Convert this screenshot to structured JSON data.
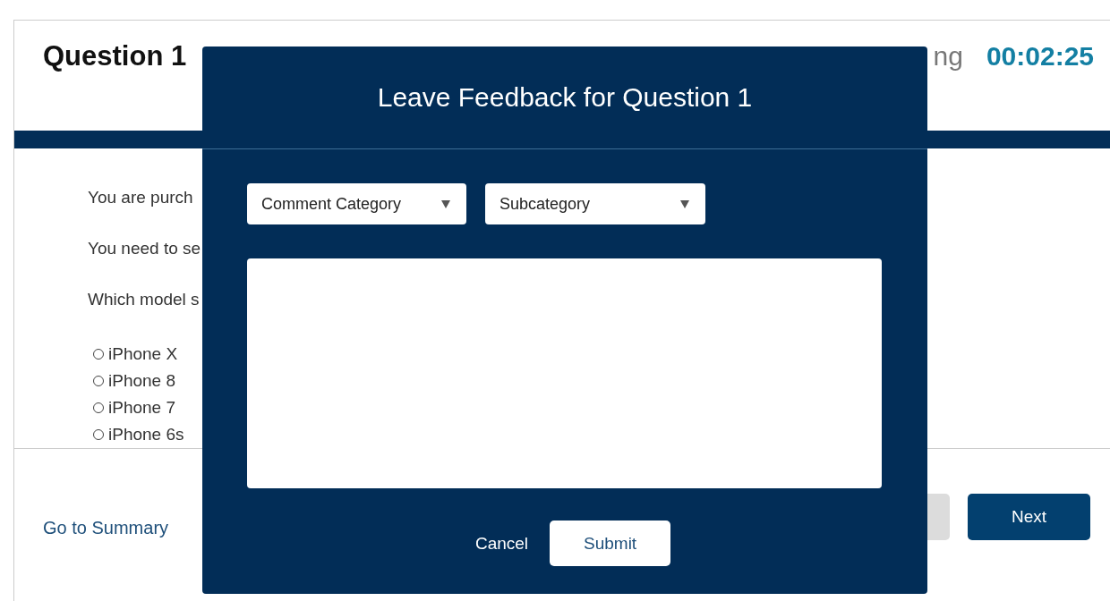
{
  "header": {
    "title": "Question 1",
    "timer_label": "ng",
    "timer": "00:02:25"
  },
  "question": {
    "lines": [
      "You are purch",
      "You need to se",
      "Which model s"
    ],
    "options": [
      {
        "label": "iPhone X",
        "selected": false
      },
      {
        "label": "iPhone 8",
        "selected": false
      },
      {
        "label": "iPhone 7",
        "selected": false
      },
      {
        "label": "iPhone 6s",
        "selected": false
      }
    ]
  },
  "footer": {
    "summary_link": "Go to Summary",
    "next_button": "Next"
  },
  "dialog": {
    "title": "Leave Feedback for Question 1",
    "category": "Comment Category",
    "subcategory": "Subcategory",
    "cancel": "Cancel",
    "submit": "Submit"
  }
}
